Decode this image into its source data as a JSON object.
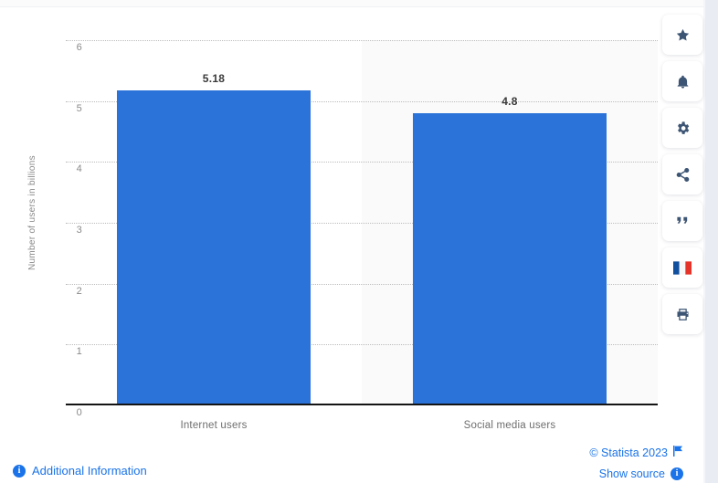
{
  "chart_data": {
    "type": "bar",
    "title": "",
    "subtitle": "",
    "xlabel": "",
    "ylabel": "Number of users in billions",
    "categories": [
      "Internet users",
      "Social media users"
    ],
    "values": [
      5.18,
      4.8
    ],
    "value_labels": [
      "5.18",
      "4.8"
    ],
    "ylim": [
      0,
      6
    ],
    "yticks": [
      0,
      1,
      2,
      3,
      4,
      5,
      6
    ],
    "ytick_labels": [
      "0",
      "1",
      "2",
      "3",
      "4",
      "5",
      "6"
    ],
    "grid": true,
    "legend": false,
    "bar_color": "#2b73d8",
    "series": [
      {
        "name": "Number of users in billions",
        "values": [
          5.18,
          4.8
        ]
      }
    ]
  },
  "axis": {
    "y_label": "Number of users in billions",
    "ticks": [
      {
        "label": "6",
        "value": 6
      },
      {
        "label": "5",
        "value": 5
      },
      {
        "label": "4",
        "value": 4
      },
      {
        "label": "3",
        "value": 3
      },
      {
        "label": "2",
        "value": 2
      },
      {
        "label": "1",
        "value": 1
      },
      {
        "label": "0",
        "value": 0
      }
    ],
    "categories": [
      {
        "label": "Internet users"
      },
      {
        "label": "Social media users"
      }
    ]
  },
  "toolbar": {
    "items": [
      {
        "icon": "star-icon",
        "name": "favorite-button"
      },
      {
        "icon": "bell-icon",
        "name": "notification-button"
      },
      {
        "icon": "gear-icon",
        "name": "settings-button"
      },
      {
        "icon": "share-icon",
        "name": "share-button"
      },
      {
        "icon": "quote-icon",
        "name": "cite-button"
      },
      {
        "icon": "flag-fr-icon",
        "name": "language-button"
      },
      {
        "icon": "printer-icon",
        "name": "print-button"
      }
    ]
  },
  "footer": {
    "additional_information": "Additional Information",
    "copyright": "© Statista 2023",
    "show_source": "Show source",
    "info_glyph": "i"
  },
  "colors": {
    "bar": "#2b73d8",
    "link": "#1a73e8",
    "icon": "#3d5574",
    "band": "#fafafa",
    "grid": "#bcbcbc",
    "axis": "#141414"
  }
}
